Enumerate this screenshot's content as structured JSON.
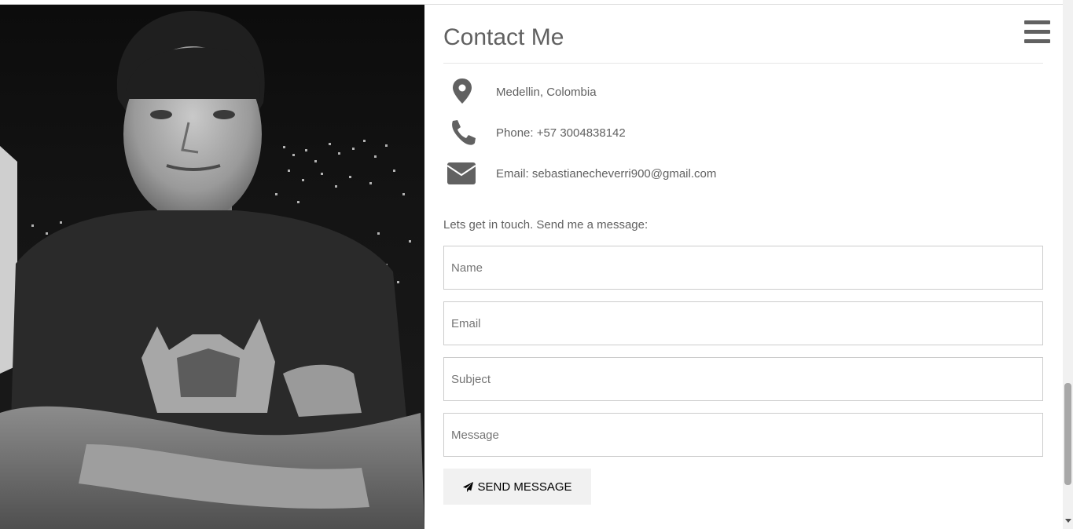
{
  "header": {
    "menu_icon": "hamburger-menu-icon"
  },
  "profile_photo": {
    "alt": "Black and white portrait photo"
  },
  "contact": {
    "title": "Contact Me",
    "items": [
      {
        "icon": "map-marker-icon",
        "text": "Medellin, Colombia"
      },
      {
        "icon": "phone-icon",
        "text": "Phone: +57 3004838142"
      },
      {
        "icon": "envelope-icon",
        "text": "Email: sebastianecheverri900@gmail.com"
      }
    ],
    "intro": "Lets get in touch. Send me a message:",
    "form": {
      "name_placeholder": "Name",
      "email_placeholder": "Email",
      "subject_placeholder": "Subject",
      "message_placeholder": "Message",
      "send_label": "SEND MESSAGE",
      "send_icon": "paper-plane-icon"
    }
  },
  "colors": {
    "text": "#616161",
    "icon": "#616161",
    "button_bg": "#f1f1f1",
    "input_border": "#cccccc"
  }
}
